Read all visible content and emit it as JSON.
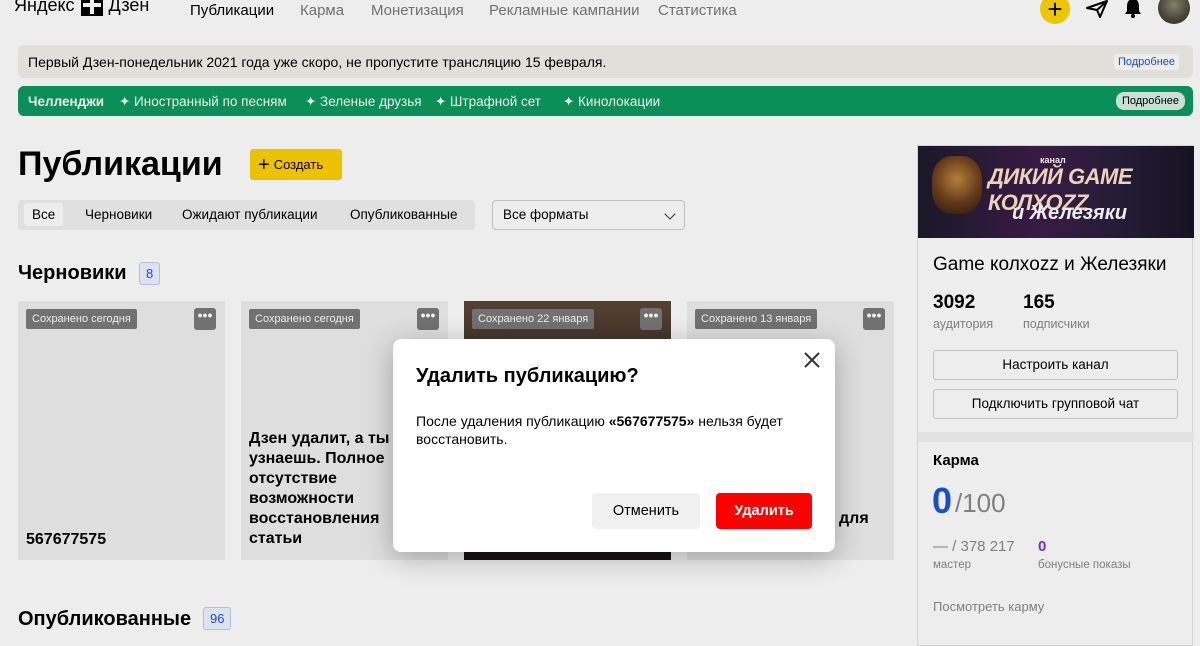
{
  "header": {
    "logo_text": "Яндекс",
    "logo_product": "Дзен",
    "nav": [
      "Публикации",
      "Карма",
      "Монетизация",
      "Рекламные кампании",
      "Статистика"
    ],
    "active_nav": "Публикации",
    "icons": [
      "plus-icon",
      "send-icon",
      "bell-icon",
      "avatar"
    ]
  },
  "banner_announcement": {
    "text": "Первый Дзен-понедельник 2021 года уже скоро, не пропустите трансляцию 15 февраля.",
    "more": "Подробнее"
  },
  "banner_challenges": {
    "title": "Челленджи",
    "items": [
      "✦ Иностранный по песням",
      "✦ Зеленые друзья",
      "✦ Штрафной сет",
      "✦ Кинолокации"
    ],
    "more": "Подробнее"
  },
  "page": {
    "title": "Публикации",
    "create_label": "Создать"
  },
  "tabs": [
    "Все",
    "Черновики",
    "Ожидают публикации",
    "Опубликованные"
  ],
  "format_select": "Все форматы",
  "drafts": {
    "title": "Черновики",
    "count": "8",
    "cards": [
      {
        "saved": "Сохранено сегодня",
        "title": "567677575",
        "menu": "•••"
      },
      {
        "saved": "Сохранено сегодня",
        "title": "Дзен удалит, а ты узнаешь. Полное отсутствие возможности восстановления статьи",
        "menu": "•••"
      },
      {
        "saved": "Сохранено 22 января",
        "title": "",
        "menu": "•••"
      },
      {
        "saved": "Сохранено 13 января",
        "title": "А для",
        "menu": "•••"
      }
    ]
  },
  "published": {
    "title": "Опубликованные",
    "count": "96"
  },
  "sidebar": {
    "cover_small": "канал",
    "cover_line1": "ДИКИЙ GAME КОЛХОZZ",
    "cover_line2": "и Железяки",
    "channel_name": "Game колхozz и Железяки",
    "audience_value": "3092",
    "audience_label": "аудитория",
    "subscribers_value": "165",
    "subscribers_label": "подписчики",
    "configure_button": "Настроить канал",
    "chat_button": "Подключить групповой чат",
    "karma_title": "Карма",
    "karma_value": "0",
    "karma_max": "/100",
    "master_value": "— / 378 217",
    "master_label": "мастер",
    "bonus_value": "0",
    "bonus_label": "бонусные показы",
    "karma_link": "Посмотреть карму"
  },
  "modal": {
    "title": "Удалить публикацию?",
    "text_before": "После удаления публикацию ",
    "text_name": "«567677575»",
    "text_after": " нельзя будет восстановить.",
    "cancel": "Отменить",
    "delete": "Удалить",
    "close_icon": "close-icon"
  },
  "colors": {
    "accent_yellow": "#ffcf00",
    "challenge_green": "#0b9a5f",
    "link_blue": "#1a55d6",
    "danger_red": "#ff0000"
  }
}
